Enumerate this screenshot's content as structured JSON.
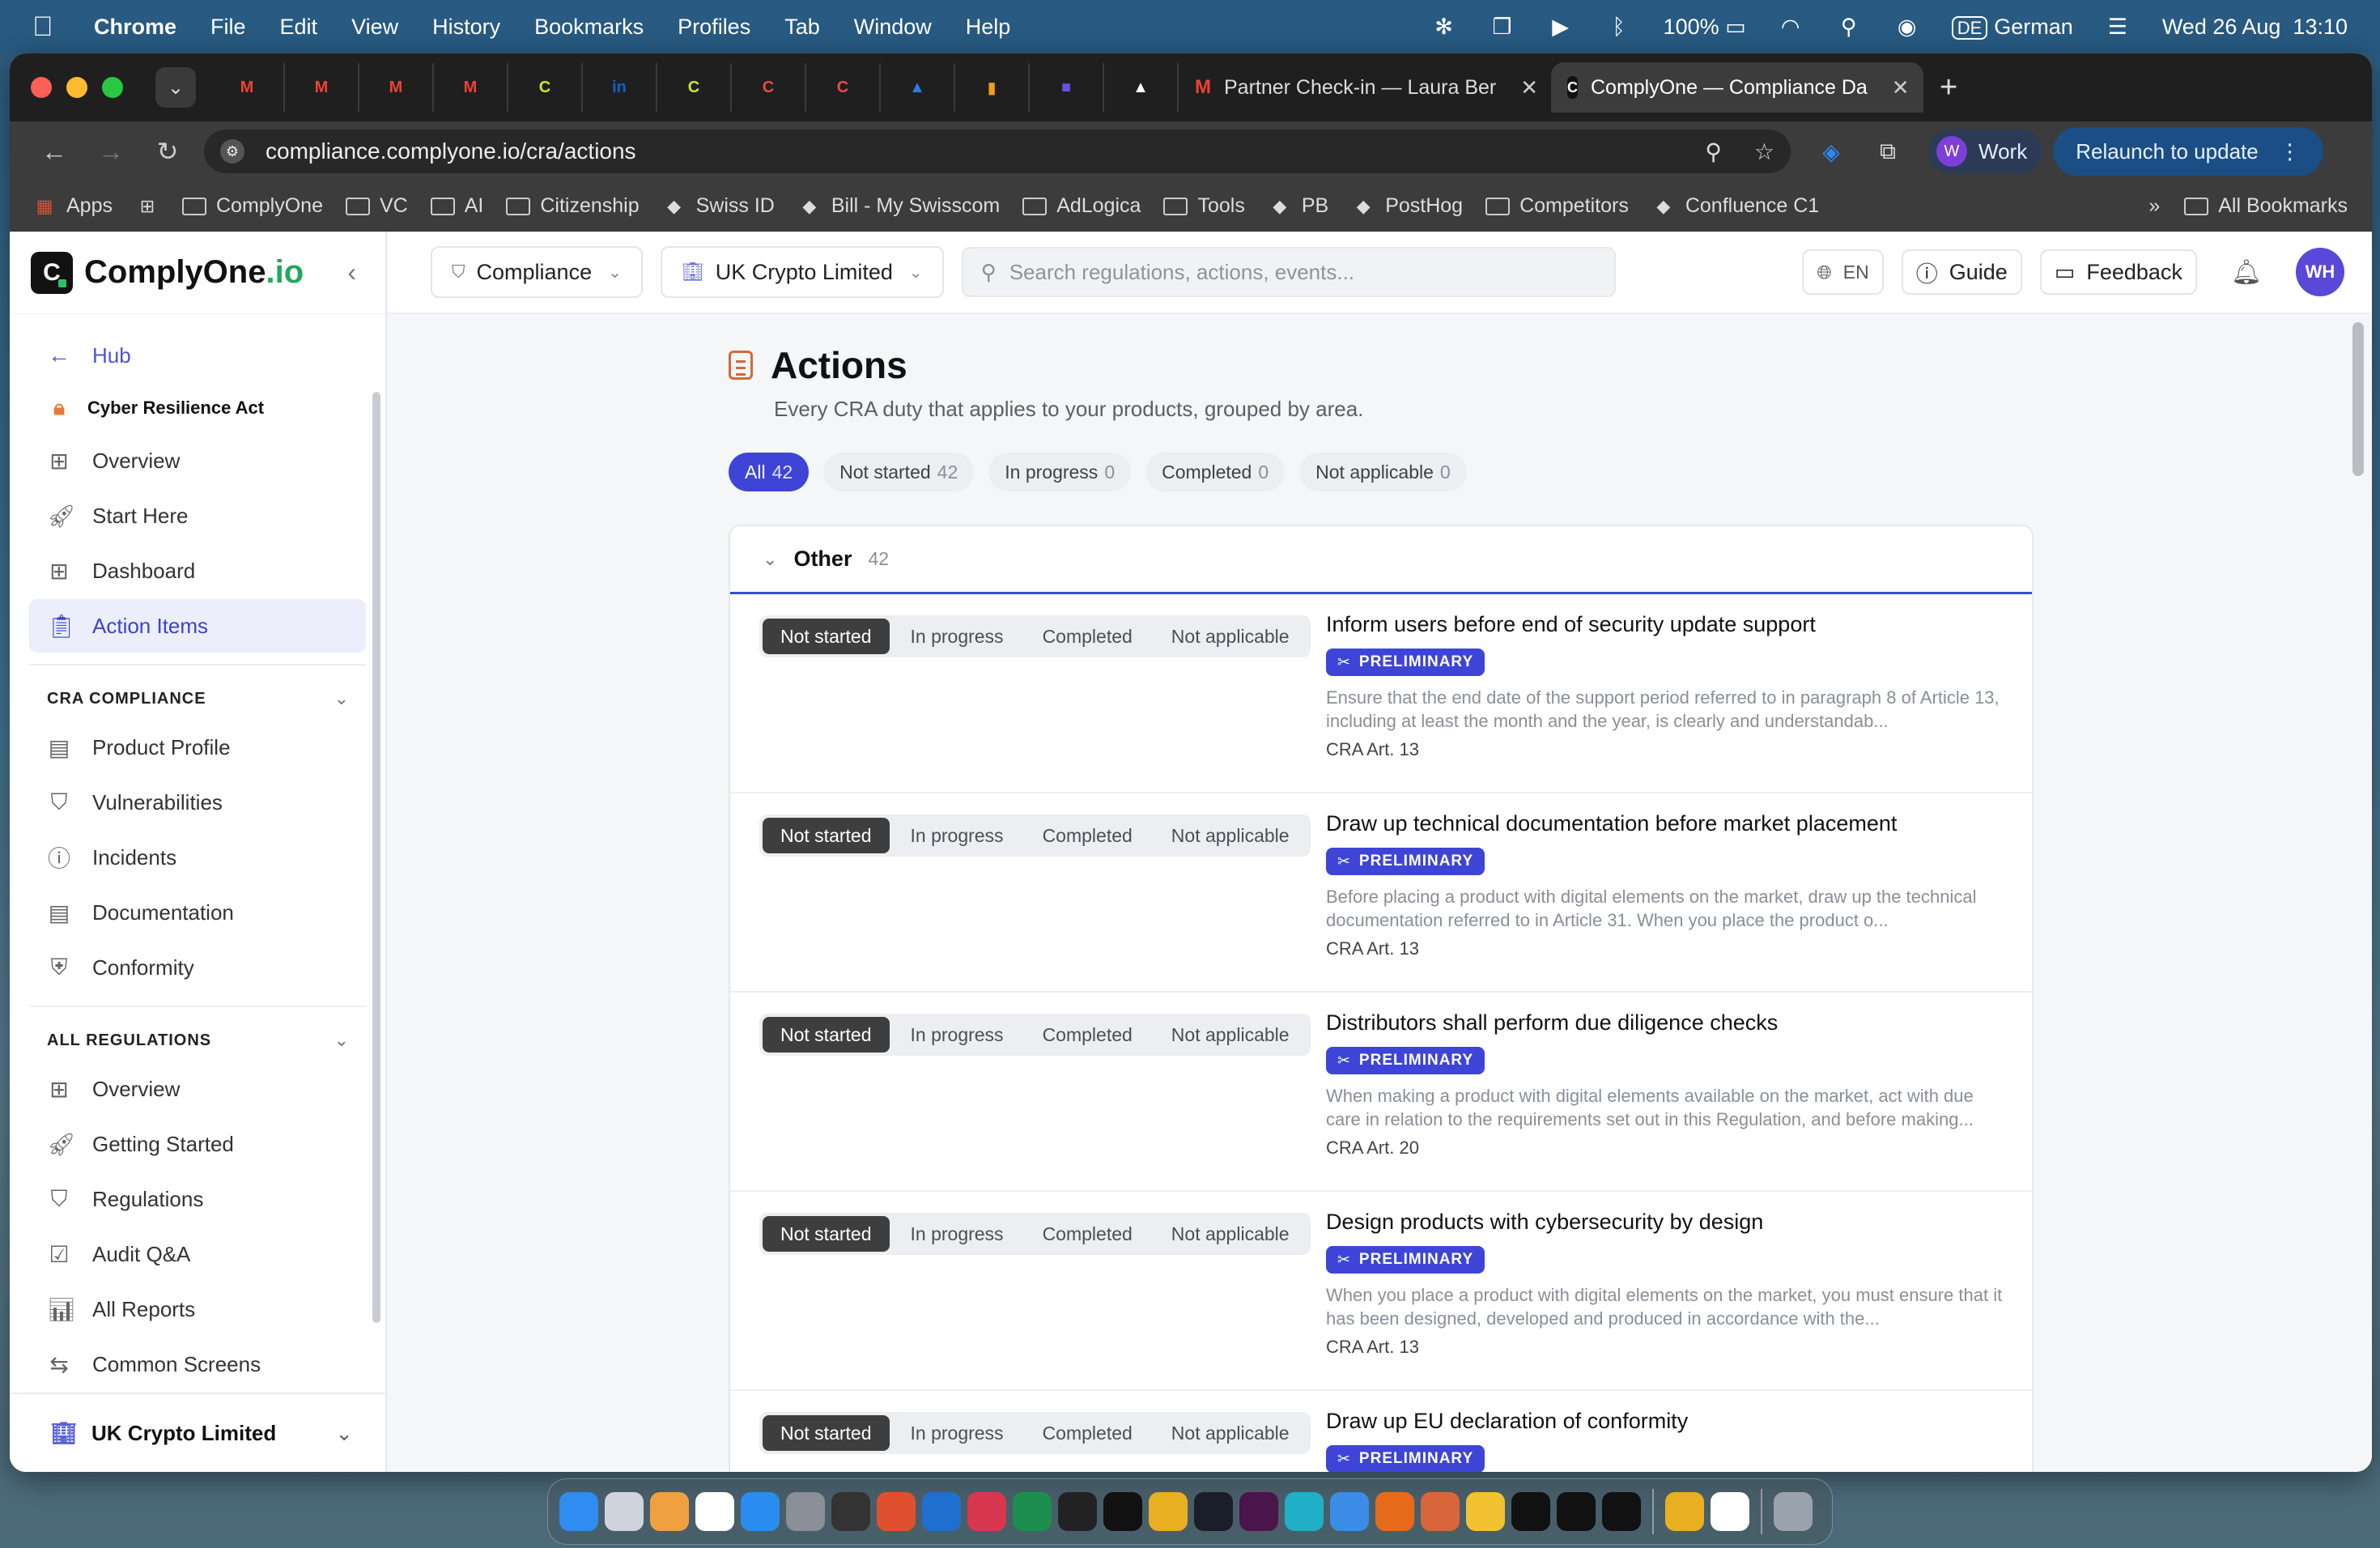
{
  "menubar": {
    "app": "Chrome",
    "items": [
      "File",
      "Edit",
      "View",
      "History",
      "Bookmarks",
      "Profiles",
      "Tab",
      "Window",
      "Help"
    ],
    "battery": "100%",
    "lang_code": "DE",
    "lang": "German",
    "datetime": "Wed 26 Aug  13:10"
  },
  "tabs": {
    "mini": [
      {
        "glyph": "M",
        "color": "#ea4335",
        "icon": "gmail-icon"
      },
      {
        "glyph": "M",
        "color": "#ea4335",
        "icon": "gmail-icon"
      },
      {
        "glyph": "M",
        "color": "#ea4335",
        "icon": "gmail-icon"
      },
      {
        "glyph": "M",
        "color": "#ea4335",
        "icon": "gmail-icon"
      },
      {
        "glyph": "C",
        "color": "#c8e63c",
        "icon": "complyone-icon"
      },
      {
        "glyph": "in",
        "color": "#0a66c2",
        "icon": "linkedin-icon"
      },
      {
        "glyph": "C",
        "color": "#c8e63c",
        "icon": "complyone-icon"
      },
      {
        "glyph": "C",
        "color": "#e84a4a",
        "icon": "complyone-icon"
      },
      {
        "glyph": "C",
        "color": "#e84a4a",
        "icon": "complyone-icon"
      },
      {
        "glyph": "▲",
        "color": "#2a7de1",
        "icon": "triangle-icon"
      },
      {
        "glyph": "▮",
        "color": "#f29b1d",
        "icon": "analytics-icon"
      },
      {
        "glyph": "■",
        "color": "#6b4de6",
        "icon": "app-icon"
      },
      {
        "glyph": "▲",
        "color": "#ffffff",
        "icon": "vercel-icon"
      }
    ],
    "partner_tab": "Partner Check-in — Laura Ber",
    "active_tab": "ComplyOne — Compliance Da"
  },
  "toolbar": {
    "url": "compliance.complyone.io/cra/actions",
    "profile_initial": "W",
    "profile_name": "Work",
    "relaunch": "Relaunch to update"
  },
  "bookmarks": {
    "apps": "Apps",
    "items": [
      {
        "label": "ComplyOne",
        "type": "folder"
      },
      {
        "label": "VC",
        "type": "folder"
      },
      {
        "label": "AI",
        "type": "folder"
      },
      {
        "label": "Citizenship",
        "type": "folder"
      },
      {
        "label": "Swiss ID",
        "type": "link"
      },
      {
        "label": "Bill - My Swisscom",
        "type": "link"
      },
      {
        "label": "AdLogica",
        "type": "folder"
      },
      {
        "label": "Tools",
        "type": "folder"
      },
      {
        "label": "PB",
        "type": "link"
      },
      {
        "label": "PostHog",
        "type": "link"
      },
      {
        "label": "Competitors",
        "type": "folder"
      },
      {
        "label": "Confluence C1",
        "type": "link"
      }
    ],
    "all": "All Bookmarks"
  },
  "sidebar": {
    "brand": "ComplyOne",
    "brand_suffix": ".io",
    "hub": "Hub",
    "cra": "Cyber Resilience Act",
    "top_items": [
      "Overview",
      "Start Here",
      "Dashboard",
      "Action Items"
    ],
    "section1": "CRA COMPLIANCE",
    "section1_items": [
      "Product Profile",
      "Vulnerabilities",
      "Incidents",
      "Documentation",
      "Conformity"
    ],
    "section2": "ALL REGULATIONS",
    "section2_items": [
      "Overview",
      "Getting Started",
      "Regulations",
      "Audit Q&A",
      "All Reports",
      "Common Screens"
    ],
    "org": "UK Crypto Limited"
  },
  "topbar": {
    "compliance": "Compliance",
    "org": "UK Crypto Limited",
    "search_placeholder": "Search regulations, actions, events...",
    "lang": "EN",
    "guide": "Guide",
    "feedback": "Feedback",
    "user_initials": "WH"
  },
  "main": {
    "title": "Actions",
    "subtitle": "Every CRA duty that applies to your products, grouped by area.",
    "filters": [
      {
        "label": "All",
        "count": "42"
      },
      {
        "label": "Not started",
        "count": "42"
      },
      {
        "label": "In progress",
        "count": "0"
      },
      {
        "label": "Completed",
        "count": "0"
      },
      {
        "label": "Not applicable",
        "count": "0"
      }
    ],
    "group": {
      "name": "Other",
      "count": "42"
    },
    "status_options": [
      "Not started",
      "In progress",
      "Completed",
      "Not applicable"
    ],
    "badge": "PRELIMINARY",
    "actions": [
      {
        "title": "Inform users before end of security update support",
        "desc": "Ensure that the end date of the support period referred to in paragraph 8 of Article 13, including at least the month and the year, is clearly and understandab...",
        "ref": "CRA Art. 13"
      },
      {
        "title": "Draw up technical documentation before market placement",
        "desc": "Before placing a product with digital elements on the market, draw up the technical documentation referred to in Article 31. When you place the product o...",
        "ref": "CRA Art. 13"
      },
      {
        "title": "Distributors shall perform due diligence checks",
        "desc": "When making a product with digital elements available on the market, act with due care in relation to the requirements set out in this Regulation, and before making...",
        "ref": "CRA Art. 20"
      },
      {
        "title": "Design products with cybersecurity by design",
        "desc": "When you place a product with digital elements on the market, you must ensure that it has been designed, developed and produced in accordance with the...",
        "ref": "CRA Art. 13"
      },
      {
        "title": "Draw up EU declaration of conformity",
        "desc": "",
        "ref": ""
      }
    ]
  },
  "dock": {
    "apps": [
      {
        "icon": "finder-icon",
        "color": "#2f8cf0"
      },
      {
        "icon": "launchpad-icon",
        "color": "#cfd4dc"
      },
      {
        "icon": "photos-icon",
        "color": "#f0a040"
      },
      {
        "icon": "calendar-icon",
        "color": "#ffffff"
      },
      {
        "icon": "appstore-icon",
        "color": "#2b8cf0"
      },
      {
        "icon": "settings-icon",
        "color": "#8a8f98"
      },
      {
        "icon": "live-icon",
        "color": "#333333"
      },
      {
        "icon": "app-icon",
        "color": "#e0502e"
      },
      {
        "icon": "outlook-icon",
        "color": "#1f6fd0"
      },
      {
        "icon": "app-icon",
        "color": "#d9364f"
      },
      {
        "icon": "excel-icon",
        "color": "#1e8e4e"
      },
      {
        "icon": "plex-icon",
        "color": "#222222"
      },
      {
        "icon": "terminal-icon",
        "color": "#111111"
      },
      {
        "icon": "chrome-icon",
        "color": "#e8b020"
      },
      {
        "icon": "speedtest-icon",
        "color": "#1a1d2a"
      },
      {
        "icon": "slack-icon",
        "color": "#4a154b"
      },
      {
        "icon": "app-icon",
        "color": "#1fb0c8"
      },
      {
        "icon": "app-icon",
        "color": "#3b8de8"
      },
      {
        "icon": "firefox-icon",
        "color": "#e66a1a"
      },
      {
        "icon": "claude-icon",
        "color": "#d9663a"
      },
      {
        "icon": "drive-icon",
        "color": "#f2c230"
      },
      {
        "icon": "app-icon",
        "color": "#111111"
      },
      {
        "icon": "app-icon",
        "color": "#111111"
      },
      {
        "icon": "chatgpt-icon",
        "color": "#111111"
      },
      {
        "icon": "chrome-icon",
        "color": "#e8b020"
      },
      {
        "icon": "clock-icon",
        "color": "#ffffff"
      },
      {
        "icon": "trash-icon",
        "color": "#9aa3ad"
      }
    ]
  }
}
